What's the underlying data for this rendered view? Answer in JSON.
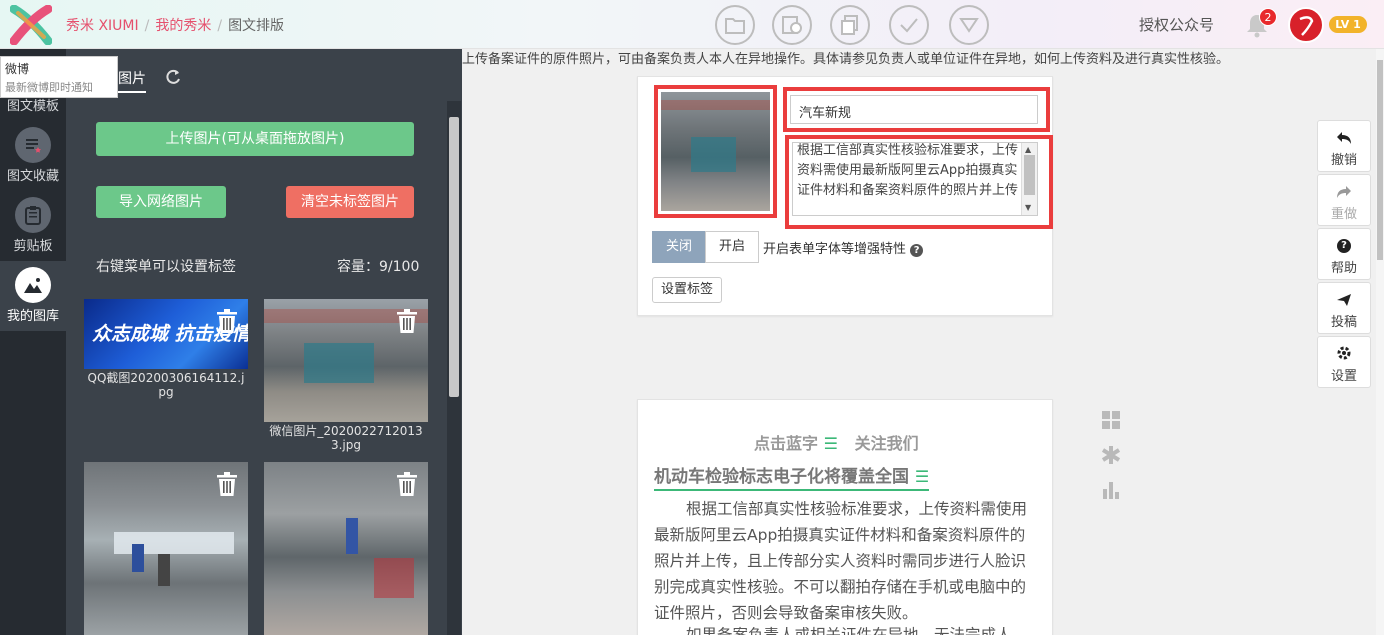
{
  "header": {
    "brand": "秀米 XIUMI",
    "crumb_mine": "我的秀米",
    "crumb_current": "图文排版",
    "authorize": "授权公众号",
    "notif_count": "2",
    "level": "LV 1",
    "toolbar_icons": [
      "folder-icon",
      "save-as-icon",
      "copy-icon",
      "check-icon",
      "dropdown-icon"
    ]
  },
  "tooltip": {
    "title": "微博",
    "subtitle": "最新微博即时通知"
  },
  "sidebar": {
    "items": [
      {
        "label": "图文模板",
        "icon": "template-icon"
      },
      {
        "label": "图文收藏",
        "icon": "favorites-icon"
      },
      {
        "label": "剪贴板",
        "icon": "clipboard-icon"
      },
      {
        "label": "我的图库",
        "icon": "gallery-icon"
      }
    ]
  },
  "library": {
    "tab": "图片",
    "upload_btn": "上传图片(可从桌面拖放图片)",
    "import_btn": "导入网络图片",
    "clear_btn": "清空未标签图片",
    "hint": "右键菜单可以设置标签",
    "capacity": "容量：9/100",
    "images": [
      {
        "name": "QQ截图20200306164112.jpg",
        "overlay": "众志成城  抗击疫情"
      },
      {
        "name": "微信图片_20200227120133.jpg"
      },
      {
        "name": ""
      },
      {
        "name": ""
      }
    ]
  },
  "editor": {
    "notice": "上传备案证件的原件照片，可由备案负责人本人在异地操作。具体请参见负责人或单位证件在异地，如何上传资料及进行真实性核验。",
    "title_value": "汽车新规",
    "description": "根据工信部真实性核验标准要求，上传资料需使用最新版阿里云App拍摄真实证件材料和备案资料原件的照片并上传",
    "toggle_off": "关闭",
    "toggle_on": "开启",
    "enhance_label": "开启表单字体等增强特性",
    "set_tag": "设置标签"
  },
  "rail": {
    "undo": "撤销",
    "redo": "重做",
    "help": "帮助",
    "submit": "投稿",
    "settings": "设置"
  },
  "article": {
    "follow": "点击蓝字",
    "follow2": "关注我们",
    "headline": "机动车检验标志电子化将覆盖全国",
    "para1": "根据工信部真实性核验标准要求，上传资料需使用最新版阿里云App拍摄真实证件材料和备案资料原件的照片并上传，且上传部分实人资料时需同步进行人脸识别完成真实性核验。不可以翻拍存储在手机或电脑中的证件照片，否则会导致备案审核失败。",
    "para2": "如果备案负责人或相关证件在异地，无法完成人"
  },
  "colors": {
    "accent_red": "#e5506d",
    "green": "#6cc88a",
    "red_button": "#ef6f63",
    "highlight_red": "#ea3d3d",
    "article_green": "#3cb878"
  }
}
